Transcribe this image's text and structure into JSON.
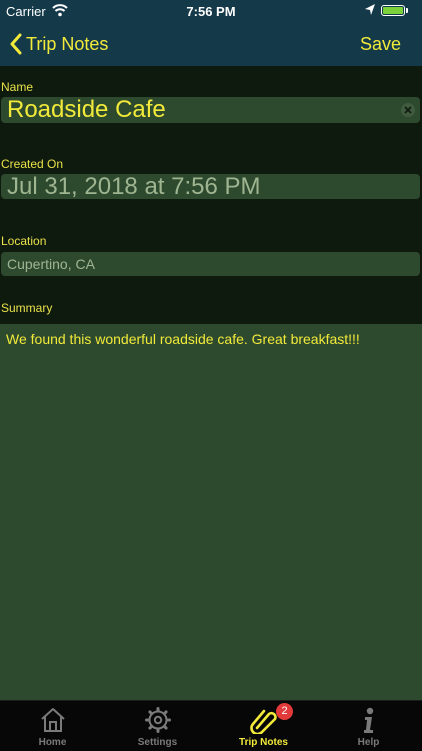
{
  "status_bar": {
    "carrier": "Carrier",
    "time": "7:56 PM",
    "battery_color": "#7bd13a"
  },
  "nav": {
    "back_label": "Trip Notes",
    "save_label": "Save"
  },
  "form": {
    "name": {
      "label": "Name",
      "value": "Roadside Cafe"
    },
    "created_on": {
      "label": "Created On",
      "value": "Jul 31, 2018 at 7:56 PM"
    },
    "location": {
      "label": "Location",
      "value": "Cupertino, CA"
    },
    "summary": {
      "label": "Summary",
      "value": "We found this wonderful roadside cafe. Great breakfast!!!"
    }
  },
  "tabs": [
    {
      "label": "Home",
      "icon": "home-icon"
    },
    {
      "label": "Settings",
      "icon": "gear-icon"
    },
    {
      "label": "Trip Notes",
      "icon": "paperclip-icon",
      "badge": "2",
      "active": true
    },
    {
      "label": "Help",
      "icon": "info-icon"
    }
  ],
  "colors": {
    "accent": "#f2ea3a",
    "nav_bg": "#143a4a",
    "field_bg": "#2e4a2e",
    "badge": "#e23a3a"
  }
}
